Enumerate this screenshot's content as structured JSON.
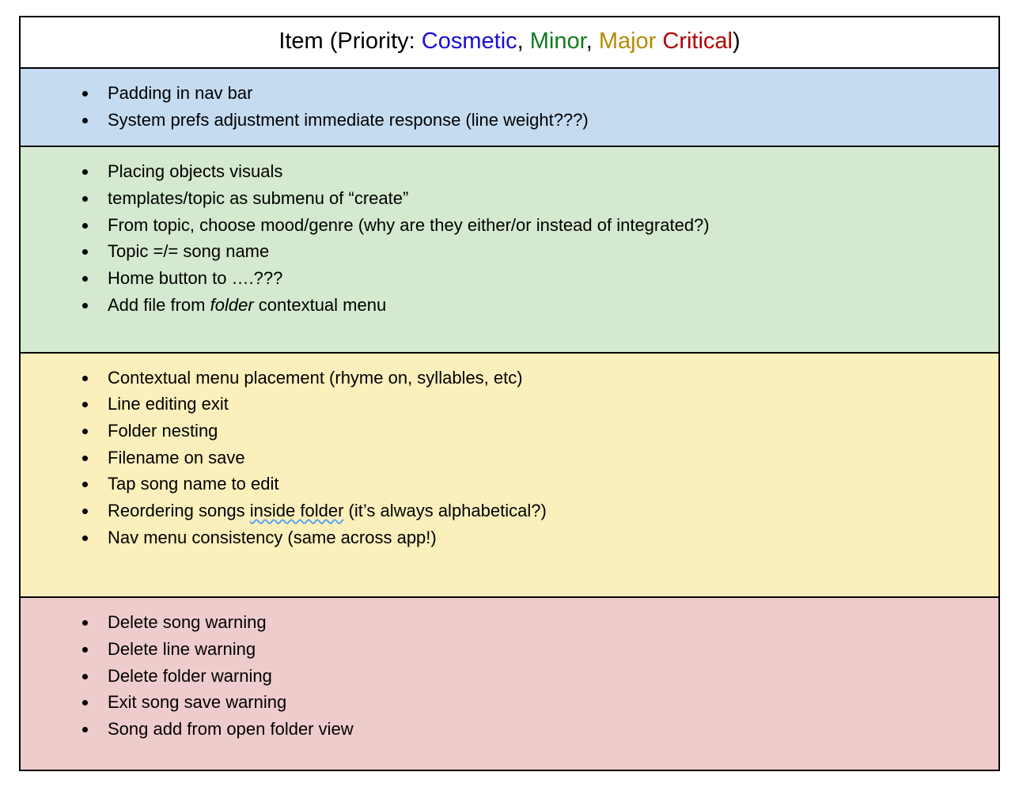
{
  "header": {
    "prefix": "Item (Priority: ",
    "cosmetic": "Cosmetic",
    "sep1": ", ",
    "minor": "Minor",
    "sep2": ", ",
    "major": "Major",
    "sep3": " ",
    "critical": "Critical",
    "suffix": ")"
  },
  "sections": {
    "cosmetic": {
      "items": {
        "i0": "Padding in nav bar",
        "i1": "System prefs adjustment immediate response (line weight???)"
      }
    },
    "minor": {
      "items": {
        "i0": "Placing objects visuals",
        "i1": "templates/topic as submenu of “create”",
        "i2": "From topic, choose mood/genre (why are they either/or instead of integrated?)",
        "i3": "Topic =/= song name",
        "i4": "Home button to ….???",
        "i5_a": "Add file from ",
        "i5_b": "folder",
        "i5_c": " contextual menu"
      }
    },
    "major": {
      "items": {
        "i0": "Contextual menu placement (rhyme on, syllables, etc)",
        "i1": "Line editing exit",
        "i2": "Folder nesting",
        "i3": "Filename on save",
        "i4": "Tap song name to edit",
        "i5_a": "Reordering songs ",
        "i5_b": "inside folder",
        "i5_c": " (it’s always alphabetical?)",
        "i6": "Nav menu consistency (same across app!)"
      }
    },
    "critical": {
      "items": {
        "i0": "Delete song warning",
        "i1": "Delete line warning",
        "i2": "Delete folder warning",
        "i3": "Exit song save warning",
        "i4": "Song add from open folder view"
      }
    }
  }
}
